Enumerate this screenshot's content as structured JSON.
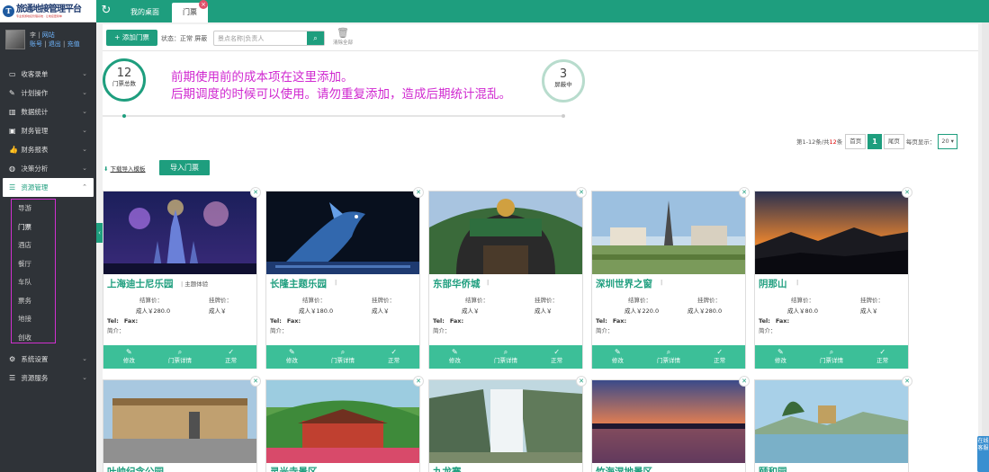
{
  "header": {
    "logo_letter": "T",
    "logo_title": "旅通地接管理平台",
    "logo_subtitle": "专业旅游地接管理系统 · 让地接更简单",
    "refresh_icon": "refresh-icon",
    "tabs": [
      {
        "label": "我的桌面",
        "active": false
      },
      {
        "label": "门票",
        "active": true
      }
    ],
    "tab_close": "×"
  },
  "sidebar": {
    "user": {
      "line1_prefix": "李",
      "line1_link": "网站",
      "line2_links": [
        "账号",
        "退出",
        "充值"
      ]
    },
    "menu": [
      {
        "icon": "monitor-icon",
        "label": "收客录单",
        "chevron": "⌄"
      },
      {
        "icon": "edit-icon",
        "label": "计划操作",
        "chevron": "⌄"
      },
      {
        "icon": "chart-icon",
        "label": "数据统计",
        "chevron": "⌄"
      },
      {
        "icon": "wallet-icon",
        "label": "财务管理",
        "chevron": "⌄"
      },
      {
        "icon": "thumb-icon",
        "label": "财务报表",
        "chevron": "⌄"
      },
      {
        "icon": "globe-icon",
        "label": "决策分析",
        "chevron": "⌄"
      },
      {
        "icon": "list-icon",
        "label": "资源管理",
        "chevron": "⌃",
        "active": true
      }
    ],
    "submenu": [
      "导游",
      "门票",
      "酒店",
      "餐厅",
      "车队",
      "票务",
      "地接",
      "创收"
    ],
    "submenu_current": 1,
    "menu_after": [
      {
        "icon": "gear-icon",
        "label": "系统设置",
        "chevron": "⌄"
      },
      {
        "icon": "list-icon",
        "label": "资源服务",
        "chevron": "⌄"
      }
    ]
  },
  "toolbar": {
    "add_label": "+ 添加门票",
    "status_label": "状态：正常 屏蔽",
    "search_placeholder": "景点名称|负责人",
    "clear_label": "清除全部"
  },
  "stats": {
    "total_num": "12",
    "total_label": "门票总数",
    "blocked_num": "3",
    "blocked_label": "屏蔽中"
  },
  "notes": [
    "前期使用前的成本项在这里添加。",
    "后期调度的时候可以使用。请勿重复添加，造成后期统计混乱。"
  ],
  "pager": {
    "info_pre": "第1-12条/共",
    "info_count": "12",
    "info_post": "条",
    "first": "首页",
    "current": "1",
    "last": "尾页",
    "per_page_label": "每页显示：",
    "per_page": "20 ▾"
  },
  "import": {
    "download_link": "下载导入模板",
    "import_btn": "导入门票"
  },
  "card_labels": {
    "settle": "结算价：",
    "list": "挂牌价：",
    "tel": "Tel:",
    "fax": "Fax:",
    "intro": "简介：",
    "actions": [
      "修改",
      "门票详情",
      "正常"
    ]
  },
  "cards": [
    {
      "title": "上海迪士尼乐园",
      "tag": "主题体验",
      "settle": "成人￥280.0",
      "list": "成人￥"
    },
    {
      "title": "长隆主题乐园",
      "tag": "",
      "settle": "成人￥180.0",
      "list": "成人￥"
    },
    {
      "title": "东部华侨城",
      "tag": "",
      "settle": "成人￥",
      "list": "成人￥"
    },
    {
      "title": "深圳世界之窗",
      "tag": "",
      "settle": "成人￥220.0",
      "list": "成人￥280.0"
    },
    {
      "title": "阴那山",
      "tag": "",
      "settle": "成人￥80.0",
      "list": "成人￥"
    }
  ],
  "cards_row2": [
    {
      "title": "叶帅纪念公园"
    },
    {
      "title": "灵光寺景区"
    },
    {
      "title": "九龙寨"
    },
    {
      "title": "竹海湿地景区"
    },
    {
      "title": "颐和园"
    }
  ],
  "float_btn": "在线客服",
  "colors": {
    "accent": "#1e9e7e",
    "note": "#d028d0",
    "sidebar": "#2f3338"
  }
}
